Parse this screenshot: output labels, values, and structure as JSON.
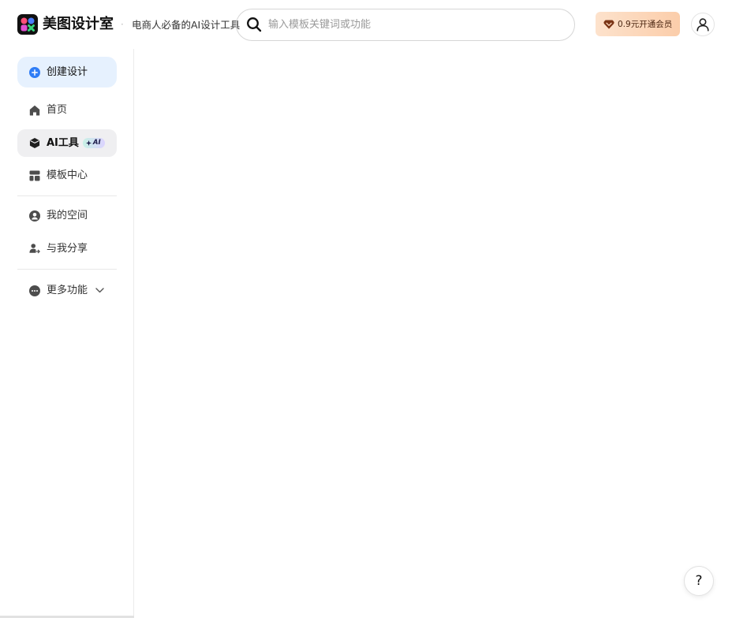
{
  "header": {
    "logo": {
      "name": "美图设计室",
      "icon": "meitu-logo-icon"
    },
    "separator": "·",
    "tagline": "电商人必备的AI设计工具",
    "search": {
      "placeholder": "输入模板关键词或功能",
      "value": "",
      "icon": "search-icon"
    },
    "vip": {
      "label": "0.9元开通会员",
      "icon": "vip-heart-icon"
    },
    "account": {
      "icon": "user-icon"
    }
  },
  "sidebar": {
    "create": {
      "label": "创建设计",
      "icon": "plus-circle-icon"
    },
    "main_nav": [
      {
        "label": "首页",
        "icon": "home-icon"
      },
      {
        "label": "AI工具",
        "icon": "cube-icon",
        "badge": "AI",
        "active": true
      },
      {
        "label": "模板中心",
        "icon": "template-icon"
      }
    ],
    "personal_nav": [
      {
        "label": "我的空间",
        "icon": "user-circle-icon"
      },
      {
        "label": "与我分享",
        "icon": "share-user-icon"
      }
    ],
    "more": {
      "label": "更多功能",
      "icon": "more-icon",
      "expand_icon": "chevron-down-icon"
    }
  },
  "help": {
    "label": "?"
  },
  "colors": {
    "accent": "#2f7df6",
    "create_bg": "#e6f1fe",
    "active_bg": "#efeff1",
    "vip_bg": "#fcd9bf",
    "vip_text": "#4a2510"
  }
}
